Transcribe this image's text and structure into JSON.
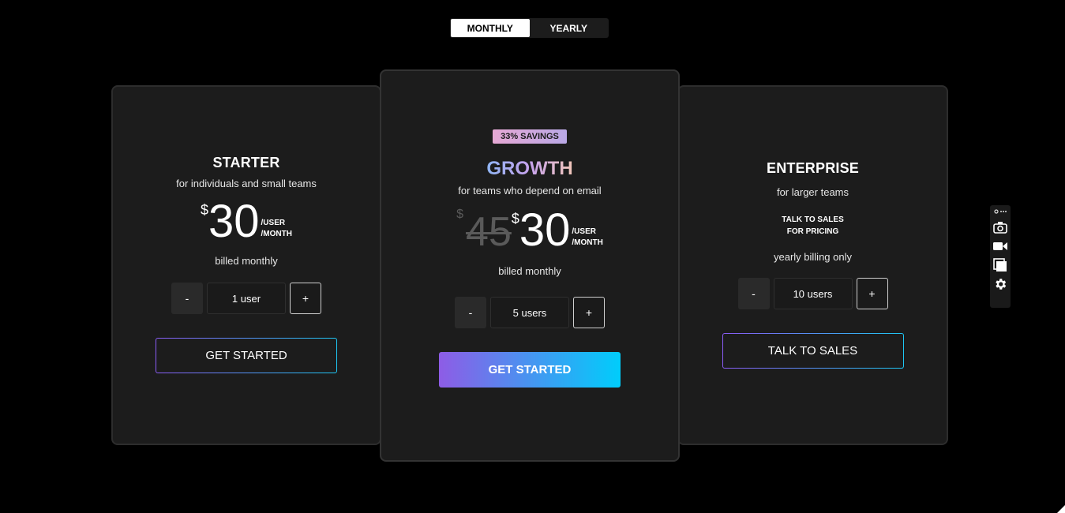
{
  "toggle": {
    "monthly": "MONTHLY",
    "yearly": "YEARLY",
    "active": "monthly"
  },
  "plans": {
    "starter": {
      "name": "STARTER",
      "subtitle": "for individuals and small teams",
      "currency": "$",
      "price": "30",
      "per_user": "/USER",
      "per_month": "/MONTH",
      "billed": "billed monthly",
      "minus": "-",
      "count": "1 user",
      "plus": "+",
      "cta": "GET STARTED"
    },
    "growth": {
      "badge": "33% SAVINGS",
      "name": "GROWTH",
      "subtitle": "for teams who depend on email",
      "old_currency": "$",
      "old_price": "45",
      "currency": "$",
      "price": "30",
      "per_user": "/USER",
      "per_month": "/MONTH",
      "billed": "billed monthly",
      "minus": "-",
      "count": "5 users",
      "plus": "+",
      "cta": "GET STARTED"
    },
    "enterprise": {
      "name": "ENTERPRISE",
      "subtitle": "for larger teams",
      "talk_line1": "TALK TO SALES",
      "talk_line2": "FOR PRICING",
      "billed": "yearly billing only",
      "minus": "-",
      "count": "10 users",
      "plus": "+",
      "cta": "TALK TO SALES"
    }
  },
  "colors": {
    "background": "#000000",
    "card": "#1c1c1c",
    "gradient_start": "#8e5ce6",
    "gradient_end": "#00cdfb"
  },
  "toolbar": {
    "icons": [
      "link-more-icon",
      "camera-icon",
      "video-icon",
      "window-icon",
      "gear-icon"
    ]
  }
}
